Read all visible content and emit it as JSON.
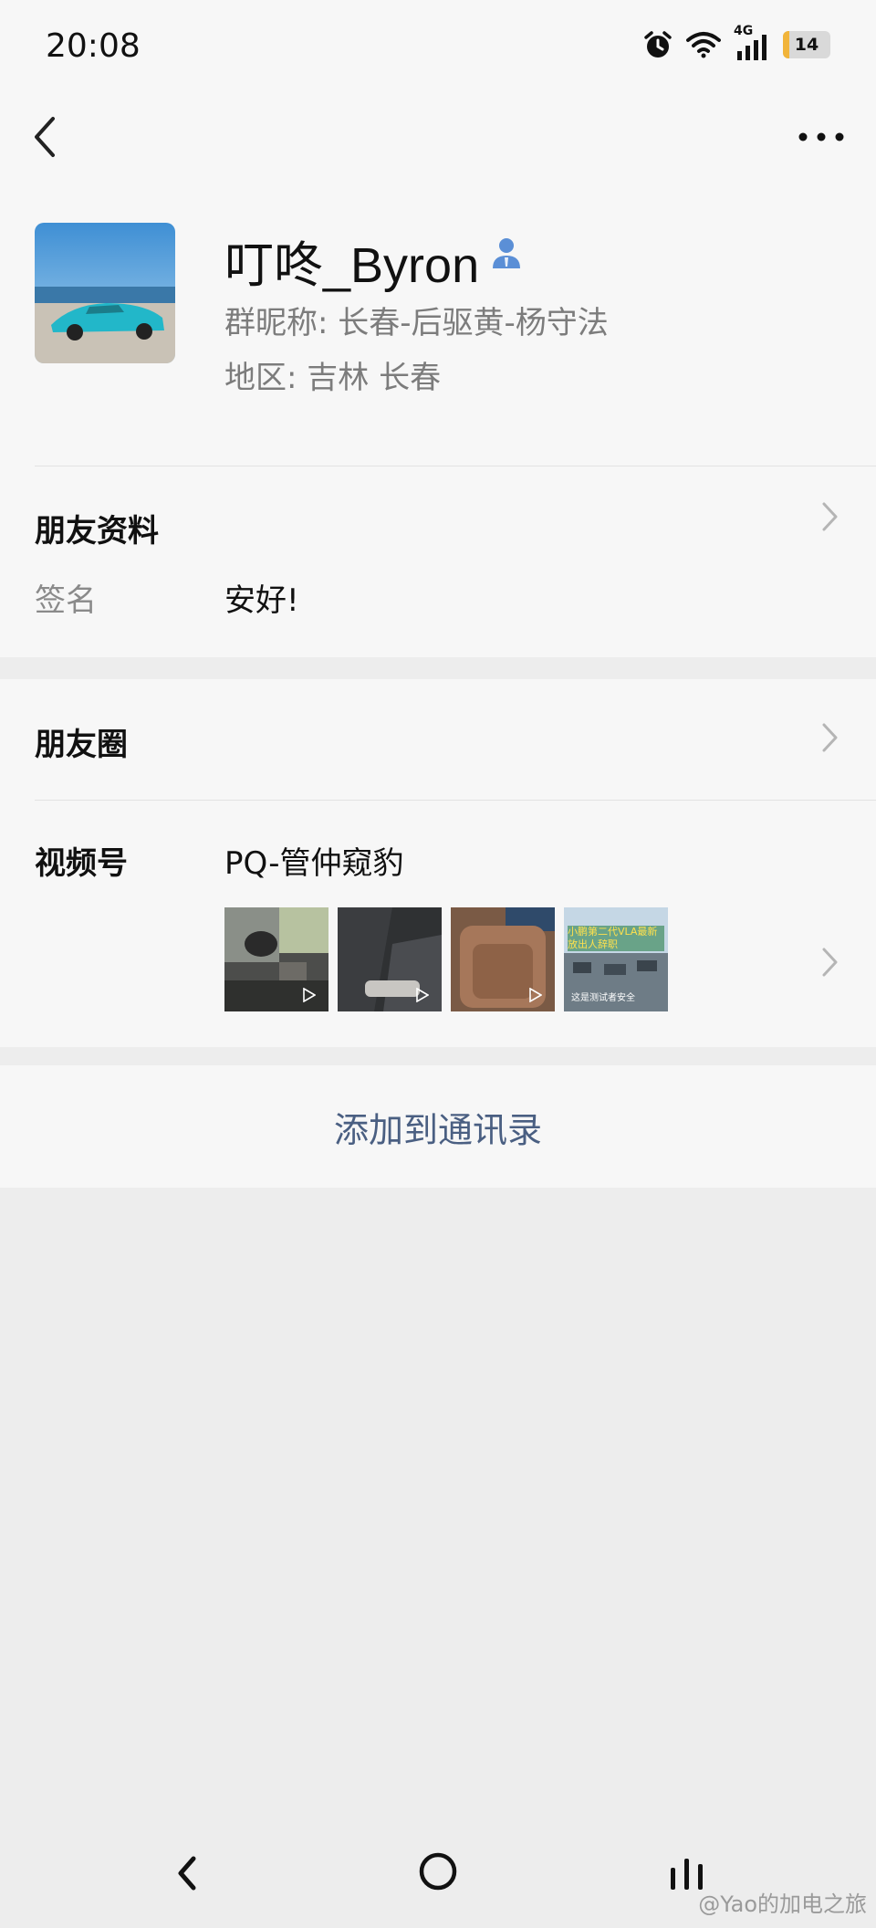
{
  "status_bar": {
    "time": "20:08",
    "network": "4G",
    "battery": "14"
  },
  "profile": {
    "display_name": "叮咚_Byron",
    "group_nickname": "群昵称:  长春-后驱黄-杨守法",
    "region": "地区:  吉林  长春"
  },
  "friend_info": {
    "title": "朋友资料",
    "signature_label": "签名",
    "signature_value": "安好!"
  },
  "moments": {
    "label": "朋友圈"
  },
  "channels": {
    "label": "视频号",
    "name": "PQ-管仲窥豹",
    "thumbnails": [
      {
        "title": ""
      },
      {
        "title": ""
      },
      {
        "title": ""
      },
      {
        "title": "小鹏第二代VLA最新 放出人辞职",
        "caption": "这是测试者安全"
      }
    ]
  },
  "add_contact": {
    "label": "添加到通讯录"
  },
  "watermark": "@Yao的加电之旅",
  "icons": {
    "back": "chevron-left-icon",
    "more": "more-dots-icon",
    "person": "person-icon",
    "chevron": "chevron-right-icon",
    "play": "play-icon"
  },
  "colors": {
    "link": "#4a5f82",
    "person_icon": "#5b8fd6",
    "battery_fill": "#f1b43a"
  }
}
